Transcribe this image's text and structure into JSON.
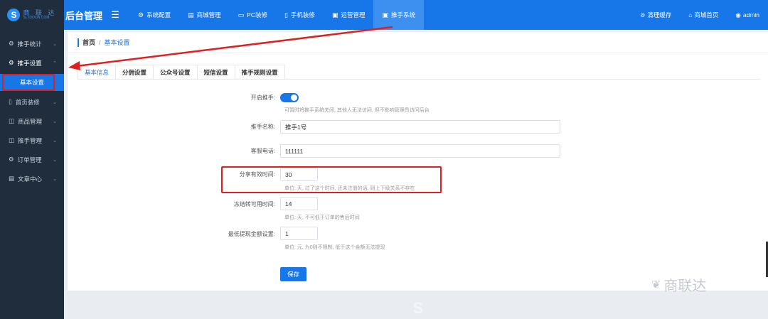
{
  "header": {
    "logo_cn": "商 联 达",
    "logo_en": "SL.IDOON.COM",
    "brand": "后台管理",
    "nav": [
      {
        "label": "系统配置",
        "icon": "☐"
      },
      {
        "label": "商城管理",
        "icon": "▤"
      },
      {
        "label": "PC装修",
        "icon": "▭"
      },
      {
        "label": "手机装修",
        "icon": "▯"
      },
      {
        "label": "运营管理",
        "icon": "▣"
      },
      {
        "label": "推手系统",
        "icon": "▣"
      }
    ],
    "right": {
      "clear_cache": "清理缓存",
      "mall_home": "商城首页",
      "user": "admin"
    }
  },
  "sidebar": {
    "items": [
      {
        "label": "推手统计"
      },
      {
        "label": "推手设置"
      },
      {
        "label": "首页装修"
      },
      {
        "label": "商品管理"
      },
      {
        "label": "推手管理"
      },
      {
        "label": "订单管理"
      },
      {
        "label": "文章中心"
      }
    ],
    "sub_active": "基本设置"
  },
  "breadcrumb": {
    "home": "首页",
    "sep": "/",
    "current": "基本设置"
  },
  "tabs": [
    "基本信息",
    "分佣设置",
    "公众号设置",
    "短信设置",
    "推手规则设置"
  ],
  "form": {
    "enable_label": "开启推手:",
    "enable_hint": "可暂时将推手系统关闭, 其他人无法访问, 但不影响管理员访问后台",
    "name_label": "推手名称:",
    "name_value": "推手1号",
    "phone_label": "客服电话:",
    "phone_value": "111111",
    "share_label": "分享有效时间:",
    "share_value": "30",
    "share_hint": "单位: 天, 过了这个时间, 还未注册的话, 则上下级关系不存在",
    "freeze_label": "冻结转可用时间:",
    "freeze_value": "14",
    "freeze_hint": "单位: 天, 不可低于订单的售后时间",
    "min_label": "最低提现金额设置:",
    "min_value": "1",
    "min_hint": "单位: 元, 为0则不限制, 低于这个金额无法提现",
    "save": "保存"
  },
  "watermark": "商联达",
  "colors": {
    "primary": "#1776e8",
    "sidebar": "#1f2d3d",
    "highlight": "#e02020"
  }
}
